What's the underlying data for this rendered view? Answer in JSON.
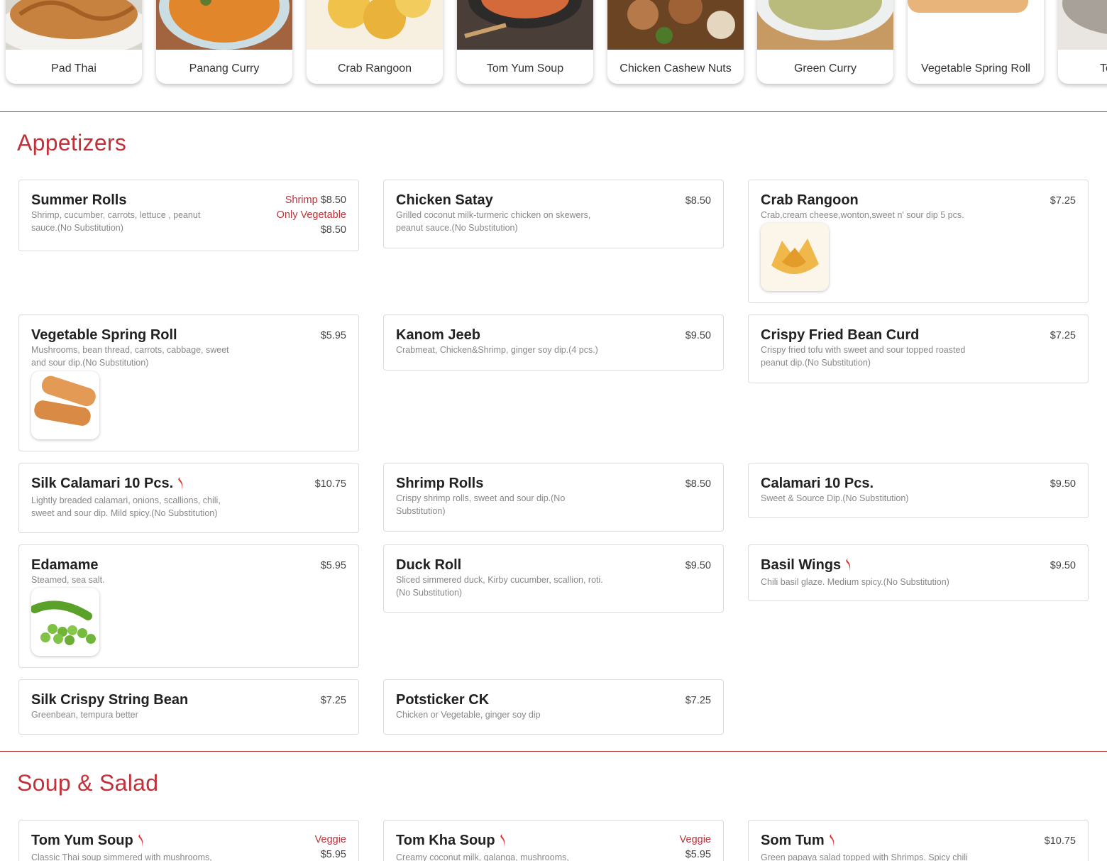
{
  "featured": [
    {
      "label": "Pad Thai",
      "color": "#c8823f"
    },
    {
      "label": "Panang Curry",
      "color": "#e2862c"
    },
    {
      "label": "Crab Rangoon",
      "color": "#f0c24a"
    },
    {
      "label": "Tom Yum Soup",
      "color": "#5d4a3e"
    },
    {
      "label": "Chicken Cashew Nuts",
      "color": "#8a5a33"
    },
    {
      "label": "Green Curry",
      "color": "#b9bb7c"
    },
    {
      "label": "Vegetable Spring Roll",
      "color": "#e8b47a"
    },
    {
      "label": "Tom Kha Soup",
      "color": "#a7a19a"
    }
  ],
  "sections": {
    "appetizers": {
      "title": "Appetizers",
      "items": [
        {
          "name": "Summer Rolls",
          "desc": "Shrimp, cucumber, carrots, lettuce , peanut sauce.(No Substitution)",
          "opt1": "Shrimp",
          "price1": "$8.50",
          "opt2": "Only Vegetable",
          "price2": "$8.50"
        },
        {
          "name": "Chicken Satay",
          "desc": "Grilled coconut milk-turmeric chicken on skewers, peanut sauce.(No Substitution)",
          "price": "$8.50"
        },
        {
          "name": "Crab Rangoon",
          "desc": "Crab,cream cheese,wonton,sweet n' sour dip 5 pcs.",
          "price": "$7.25",
          "image": "crab-rangoon-photo"
        },
        {
          "name": "Vegetable Spring Roll",
          "desc": "Mushrooms, bean thread, carrots, cabbage, sweet and sour dip.(No Substitution)",
          "price": "$5.95",
          "image": "spring-roll-photo"
        },
        {
          "name": "Kanom Jeeb",
          "desc": "Crabmeat, Chicken&Shrimp, ginger soy dip.(4 pcs.)",
          "price": "$9.50"
        },
        {
          "name": "Crispy Fried Bean Curd",
          "desc": "Crispy fried tofu with sweet and sour topped roasted peanut dip.(No Substitution)",
          "price": "$7.25"
        },
        {
          "name": "Silk Calamari 10 Pcs.",
          "desc": "Lightly breaded calamari, onions, scallions, chili, sweet and sour dip. Mild spicy.(No Substitution)",
          "price": "$10.75",
          "spicy": true
        },
        {
          "name": "Shrimp Rolls",
          "desc": "Crispy shrimp rolls, sweet and sour dip.(No Substitution)",
          "price": "$8.50"
        },
        {
          "name": "Calamari 10 Pcs.",
          "desc": "Sweet & Source Dip.(No Substitution)",
          "price": "$9.50"
        },
        {
          "name": "Edamame",
          "desc": "Steamed, sea salt.",
          "price": "$5.95",
          "image": "edamame-photo"
        },
        {
          "name": "Duck Roll",
          "desc": "Sliced simmered duck, Kirby cucumber, scallion, roti.(No Substitution)",
          "price": "$9.50"
        },
        {
          "name": "Basil Wings",
          "desc": "Chili basil glaze. Medium spicy.(No Substitution)",
          "price": "$9.50",
          "spicy": true
        },
        {
          "name": "Silk Crispy String Bean",
          "desc": "Greenbean, tempura better",
          "price": "$7.25"
        },
        {
          "name": "Potsticker CK",
          "desc": "Chicken or Vegetable, ginger soy dip",
          "price": "$7.25"
        }
      ]
    },
    "soup_salad": {
      "title": "Soup & Salad",
      "items": [
        {
          "name": "Tom Yum Soup",
          "desc": "Classic Thai soup simmered with mushrooms,",
          "opt1": "Veggie",
          "price1": "$5.95",
          "spicy": true
        },
        {
          "name": "Tom Kha Soup",
          "desc": "Creamy coconut milk, galanga, mushrooms,",
          "opt1": "Veggie",
          "price1": "$5.95",
          "spicy": true
        },
        {
          "name": "Som Tum",
          "desc": "Green papaya salad topped with Shrimps. Spicy chili",
          "price": "$10.75",
          "spicy": true
        }
      ]
    }
  },
  "colors": {
    "accent": "#c0313a",
    "divider": "#b3302f",
    "chili": "#d9352a"
  }
}
